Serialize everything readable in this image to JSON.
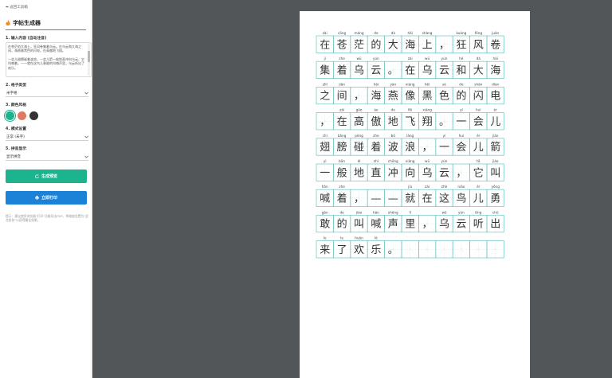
{
  "sidebar": {
    "back_label": "⬅ 返回工具箱",
    "app_title": "字帖生成器",
    "input_label": "1. 输入内容 (自动注音)",
    "input_paragraphs": [
      "在苍茫的大海上，狂风卷集着乌云。在乌云和大海之间，海燕像黑色的闪电，在高傲地飞翔。",
      "一会儿翅膀碰着波浪，一会儿箭一般地直冲向乌云，它叫喊着，——就在这鸟儿勇敢的叫喊声里，乌云听出了欢乐。"
    ],
    "grid_label": "2. 格子类型",
    "grid_value": "米字格",
    "color_label": "3. 颜色风格",
    "colors": [
      "#1cb48f",
      "#e07a63",
      "#333333"
    ],
    "mode_label": "4. 模式设置",
    "mode_value": "正常 (未字)",
    "pinyin_label": "5. 拼音显示",
    "pinyin_value": "显示拼音",
    "preview_label": "生成预览",
    "print_label": "立即打印",
    "tip": "提示：建议使用浏览器\"打印\"功能导出PDF，将缩放设置为\"适合纸张\"以获得最佳效果。"
  },
  "sheet": {
    "grid_color": "#6cc4c0",
    "guide_color": "#c8e6e4",
    "cells_per_row": 11,
    "rows": [
      [
        [
          "zài",
          "在"
        ],
        [
          "cāng",
          "苍"
        ],
        [
          "máng",
          "茫"
        ],
        [
          "de",
          "的"
        ],
        [
          "dà",
          "大"
        ],
        [
          "hǎi",
          "海"
        ],
        [
          "shàng",
          "上"
        ],
        [
          "",
          "，"
        ],
        [
          "kuáng",
          "狂"
        ],
        [
          "fēng",
          "风"
        ],
        [
          "juǎn",
          "卷"
        ]
      ],
      [
        [
          "jí",
          "集"
        ],
        [
          "zhe",
          "着"
        ],
        [
          "wū",
          "乌"
        ],
        [
          "yún",
          "云"
        ],
        [
          "",
          "。"
        ],
        [
          "zài",
          "在"
        ],
        [
          "wū",
          "乌"
        ],
        [
          "yún",
          "云"
        ],
        [
          "hé",
          "和"
        ],
        [
          "dà",
          "大"
        ],
        [
          "hǎi",
          "海"
        ]
      ],
      [
        [
          "zhī",
          "之"
        ],
        [
          "jiān",
          "间"
        ],
        [
          "",
          "，"
        ],
        [
          "hǎi",
          "海"
        ],
        [
          "yàn",
          "燕"
        ],
        [
          "xiàng",
          "像"
        ],
        [
          "hēi",
          "黑"
        ],
        [
          "sè",
          "色"
        ],
        [
          "de",
          "的"
        ],
        [
          "shǎn",
          "闪"
        ],
        [
          "diàn",
          "电"
        ]
      ],
      [
        [
          "",
          "，"
        ],
        [
          "zài",
          "在"
        ],
        [
          "gāo",
          "高"
        ],
        [
          "ào",
          "傲"
        ],
        [
          "de",
          "地"
        ],
        [
          "fēi",
          "飞"
        ],
        [
          "xiáng",
          "翔"
        ],
        [
          "",
          "。"
        ],
        [
          "yí",
          "一"
        ],
        [
          "huì",
          "会"
        ],
        [
          "ér",
          "儿"
        ]
      ],
      [
        [
          "chì",
          "翅"
        ],
        [
          "bǎng",
          "膀"
        ],
        [
          "pèng",
          "碰"
        ],
        [
          "zhe",
          "着"
        ],
        [
          "bō",
          "波"
        ],
        [
          "làng",
          "浪"
        ],
        [
          "",
          "，"
        ],
        [
          "yí",
          "一"
        ],
        [
          "huì",
          "会"
        ],
        [
          "ér",
          "儿"
        ],
        [
          "jiàn",
          "箭"
        ]
      ],
      [
        [
          "yì",
          "一"
        ],
        [
          "bān",
          "般"
        ],
        [
          "dì",
          "地"
        ],
        [
          "zhí",
          "直"
        ],
        [
          "chōng",
          "冲"
        ],
        [
          "xiàng",
          "向"
        ],
        [
          "wū",
          "乌"
        ],
        [
          "yún",
          "云"
        ],
        [
          "",
          "，"
        ],
        [
          "tā",
          "它"
        ],
        [
          "jiào",
          "叫"
        ]
      ],
      [
        [
          "hǎn",
          "喊"
        ],
        [
          "zhe",
          "着"
        ],
        [
          "",
          "，"
        ],
        [
          "",
          "—"
        ],
        [
          "",
          "—"
        ],
        [
          "jiù",
          "就"
        ],
        [
          "zài",
          "在"
        ],
        [
          "zhè",
          "这"
        ],
        [
          "niǎo",
          "鸟"
        ],
        [
          "ér",
          "儿"
        ],
        [
          "yǒng",
          "勇"
        ]
      ],
      [
        [
          "gǎn",
          "敢"
        ],
        [
          "de",
          "的"
        ],
        [
          "jiào",
          "叫"
        ],
        [
          "hǎn",
          "喊"
        ],
        [
          "shēng",
          "声"
        ],
        [
          "lǐ",
          "里"
        ],
        [
          "",
          "，"
        ],
        [
          "wū",
          "乌"
        ],
        [
          "yún",
          "云"
        ],
        [
          "tīng",
          "听"
        ],
        [
          "chū",
          "出"
        ]
      ],
      [
        [
          "le",
          "来"
        ],
        [
          "le",
          "了"
        ],
        [
          "huān",
          "欢"
        ],
        [
          "lè",
          "乐"
        ],
        [
          "",
          "。"
        ],
        [
          "",
          ""
        ],
        [
          "",
          ""
        ],
        [
          "",
          ""
        ],
        [
          "",
          ""
        ],
        [
          "",
          ""
        ],
        [
          "",
          ""
        ]
      ]
    ]
  }
}
